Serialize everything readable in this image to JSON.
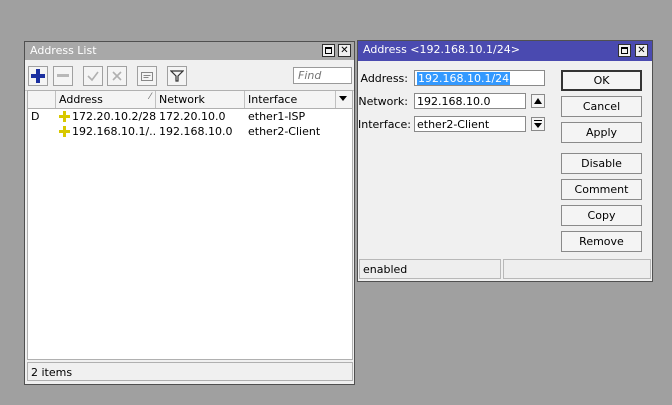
{
  "address_list": {
    "title": "Address List",
    "find_placeholder": "Find",
    "columns": [
      "Address",
      "Network",
      "Interface"
    ],
    "rows": [
      {
        "flag": "D",
        "address": "172.20.10.2/28",
        "network": "172.20.10.0",
        "interface": "ether1-ISP"
      },
      {
        "flag": "",
        "address": "192.168.10.1/...",
        "network": "192.168.10.0",
        "interface": "ether2-Client"
      }
    ],
    "status": "2 items"
  },
  "address_window": {
    "title": "Address <192.168.10.1/24>",
    "address_label": "Address:",
    "address_value": "192.168.10.1/24",
    "network_label": "Network:",
    "network_value": "192.168.10.0",
    "interface_label": "Interface:",
    "interface_value": "ether2-Client",
    "buttons": {
      "ok": "OK",
      "cancel": "Cancel",
      "apply": "Apply",
      "disable": "Disable",
      "comment": "Comment",
      "copy": "Copy",
      "remove": "Remove"
    },
    "status": "enabled"
  },
  "colors": {
    "active_title": "#4a4ab0",
    "inactive_title": "#a8a8a8",
    "selection": "#3399ff",
    "add_icon": "#1a2fa0",
    "address_icon": "#d8c800"
  },
  "icons": {
    "add": "plus-icon",
    "remove": "minus-icon",
    "enable": "check-icon",
    "disable": "cross-icon",
    "comment": "comment-icon",
    "filter": "filter-icon",
    "address": "address-plus-icon",
    "sort": "sort-arrow-icon",
    "column_menu": "dropdown-arrow-icon"
  }
}
